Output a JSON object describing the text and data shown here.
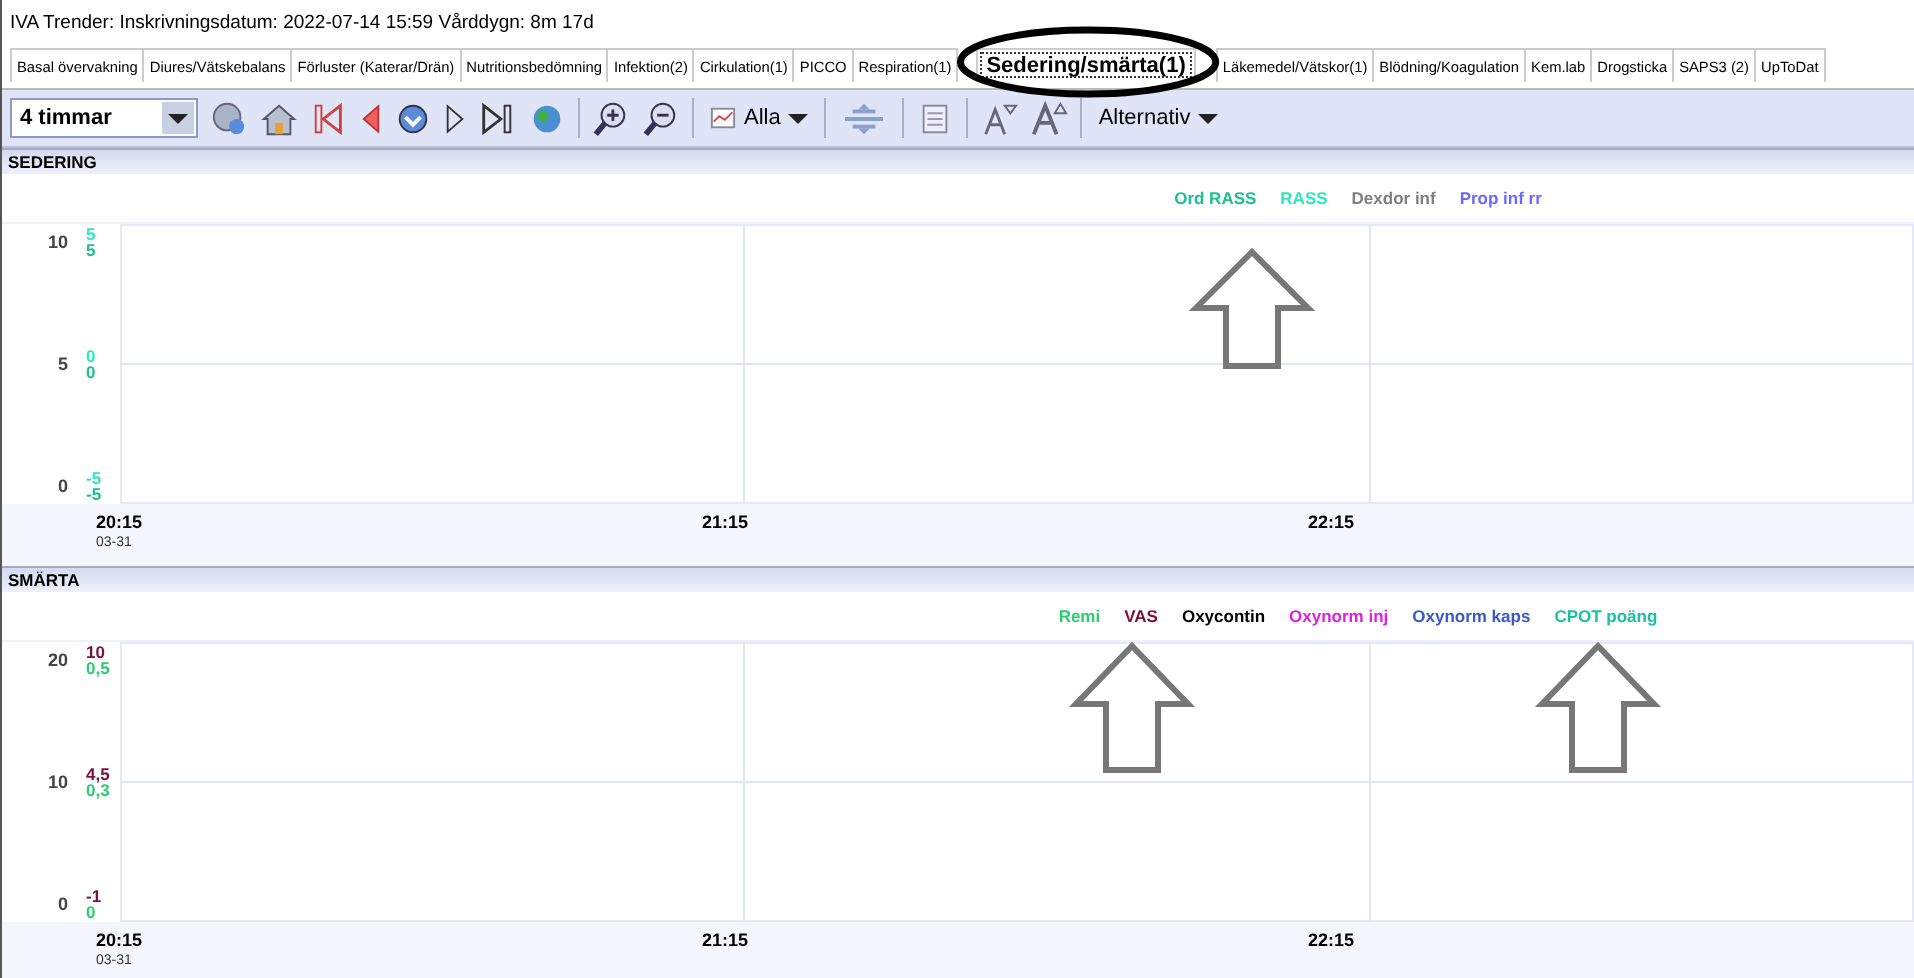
{
  "window": {
    "title": "IVA Trender: Inskrivningsdatum: 2022-07-14 15:59   Vårddygn: 8m 17d"
  },
  "tabs": [
    {
      "label": "Basal övervakning",
      "selected": false
    },
    {
      "label": "Diures/Vätskebalans",
      "selected": false
    },
    {
      "label": "Förluster (Katerar/Drän)",
      "selected": false
    },
    {
      "label": "Nutritionsbedömning",
      "selected": false
    },
    {
      "label": "Infektion(2)",
      "selected": false
    },
    {
      "label": "Cirkulation(1)",
      "selected": false
    },
    {
      "label": "PICCO",
      "selected": false
    },
    {
      "label": "Respiration(1)",
      "selected": false
    },
    {
      "label": "Sedering/smärta(1)",
      "selected": true
    },
    {
      "label": "Läkemedel/Vätskor(1)",
      "selected": false
    },
    {
      "label": "Blödning/Koagulation",
      "selected": false
    },
    {
      "label": "Kem.lab",
      "selected": false
    },
    {
      "label": "Drogsticka",
      "selected": false
    },
    {
      "label": "SAPS3 (2)",
      "selected": false
    },
    {
      "label": "UpToDat",
      "selected": false
    }
  ],
  "toolbar": {
    "range": "4 timmar",
    "series_filter": "Alla",
    "options": "Alternativ"
  },
  "panels": [
    {
      "title": "SEDERING",
      "legend": [
        {
          "label": "Ord RASS",
          "color": "#1fbf8f"
        },
        {
          "label": "RASS",
          "color": "#2ee8b8"
        },
        {
          "label": "Dexdor inf",
          "color": "#808080"
        },
        {
          "label": "Prop inf rr",
          "color": "#6a6aff"
        }
      ],
      "y_ticks": [
        {
          "label": "10",
          "scales": [
            {
              "text": "5",
              "color": "#2ee8b8"
            },
            {
              "text": "5",
              "color": "#1fbf8f"
            }
          ]
        },
        {
          "label": "5",
          "scales": [
            {
              "text": "0",
              "color": "#2ee8b8"
            },
            {
              "text": "0",
              "color": "#1fbf8f"
            }
          ]
        },
        {
          "label": "0",
          "scales": [
            {
              "text": "-5",
              "color": "#2ee8b8"
            },
            {
              "text": "-5",
              "color": "#1fbf8f"
            }
          ]
        }
      ],
      "x_ticks": [
        {
          "time": "20:15",
          "date": "03-31"
        },
        {
          "time": "21:15"
        },
        {
          "time": "22:15"
        }
      ]
    },
    {
      "title": "SMÄRTA",
      "legend": [
        {
          "label": "Remi",
          "color": "#2ecc71"
        },
        {
          "label": "VAS",
          "color": "#7a1040"
        },
        {
          "label": "Oxycontin",
          "color": "#000000"
        },
        {
          "label": "Oxynorm inj",
          "color": "#e020e0"
        },
        {
          "label": "Oxynorm kaps",
          "color": "#3a5ac8"
        },
        {
          "label": "CPOT poäng",
          "color": "#1ac0a0"
        }
      ],
      "y_ticks": [
        {
          "label": "20",
          "scales": [
            {
              "text": "10",
              "color": "#7a1040"
            },
            {
              "text": "0,5",
              "color": "#2ecc71"
            }
          ]
        },
        {
          "label": "10",
          "scales": [
            {
              "text": "4,5",
              "color": "#7a1040"
            },
            {
              "text": "0,3",
              "color": "#2ecc71"
            }
          ]
        },
        {
          "label": "0",
          "scales": [
            {
              "text": "-1",
              "color": "#7a1040"
            },
            {
              "text": "0",
              "color": "#2ecc71"
            }
          ]
        }
      ],
      "x_ticks": [
        {
          "time": "20:15",
          "date": "03-31"
        },
        {
          "time": "21:15"
        },
        {
          "time": "22:15"
        }
      ]
    }
  ]
}
